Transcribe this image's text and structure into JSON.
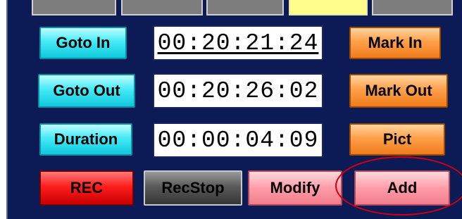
{
  "controls": {
    "goto_in": "Goto In",
    "goto_out": "Goto Out",
    "duration": "Duration",
    "mark_in": "Mark In",
    "mark_out": "Mark Out",
    "pict": "Pict",
    "rec": "REC",
    "rec_stop": "RecStop",
    "modify": "Modify",
    "add": "Add"
  },
  "timecodes": {
    "in": "00:20:21:24",
    "out": "00:20:26:02",
    "duration": "00:00:04:09"
  },
  "colors": {
    "panel_bg": "#0c1a55",
    "highlight_annotation": "#d00010",
    "top_selected_tab": "#fffe8c"
  }
}
